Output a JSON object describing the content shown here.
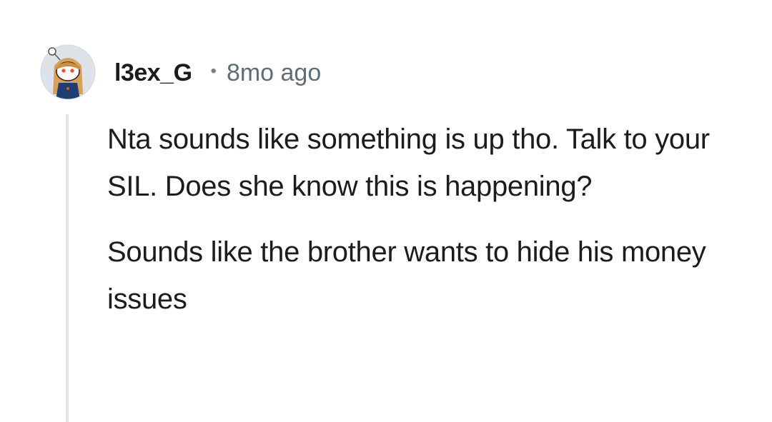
{
  "comment": {
    "username": "l3ex_G",
    "separator": "•",
    "timestamp": "8mo ago",
    "avatar_icon": "reddit-snoo-avatar-icon",
    "paragraphs": [
      "Nta sounds like something is up tho. Talk to your SIL. Does she know this is happening?",
      "Sounds like the brother wants to hide his money issues"
    ]
  },
  "colors": {
    "text": "#1c1c1c",
    "meta": "#5f6d78",
    "thread_line": "#e3e3e3",
    "background": "#ffffff"
  }
}
